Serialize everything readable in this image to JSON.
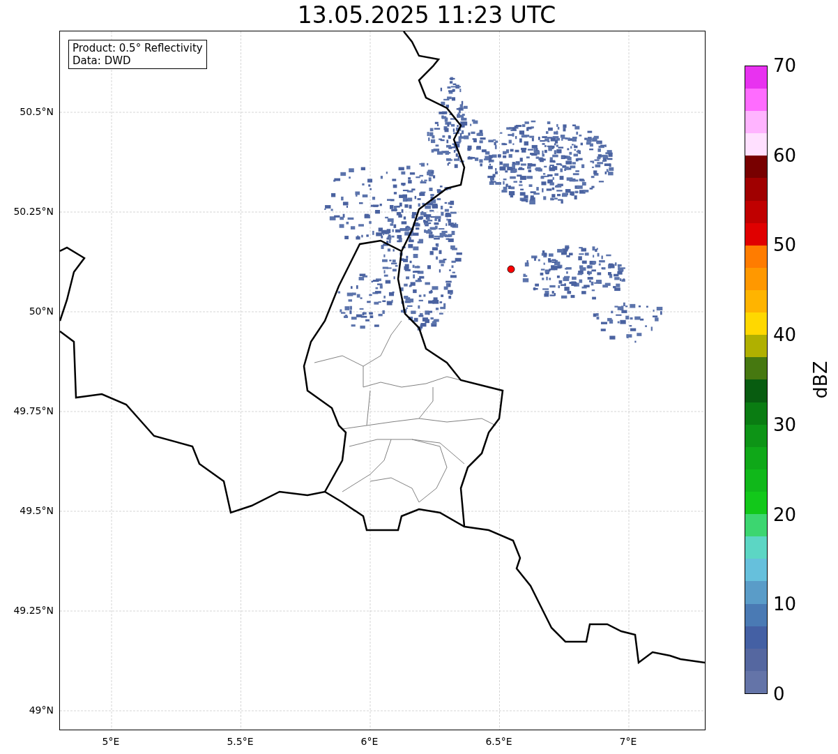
{
  "title": "13.05.2025 11:23 UTC",
  "info_box": {
    "lines": [
      "Product: 0.5° Reflectivity",
      "Data: DWD"
    ]
  },
  "map": {
    "xticks": [
      "5°E",
      "5.5°E",
      "6°E",
      "6.5°E",
      "7°E"
    ],
    "yticks": [
      "50.5°N",
      "50.25°N",
      "50°N",
      "49.75°N",
      "49.5°N",
      "49.25°N",
      "49°N"
    ],
    "radar_site": {
      "color": "#ff0000"
    }
  },
  "colorbar": {
    "label": "dBZ",
    "ticks": [
      "70",
      "60",
      "50",
      "40",
      "30",
      "20",
      "10",
      "0"
    ],
    "segments": [
      {
        "color": "#6474a8"
      },
      {
        "color": "#5567a0"
      },
      {
        "color": "#4460a4"
      },
      {
        "color": "#4a7ab4"
      },
      {
        "color": "#5a9cc8"
      },
      {
        "color": "#66c0dc"
      },
      {
        "color": "#5cd6c4"
      },
      {
        "color": "#3cd670"
      },
      {
        "color": "#12c81a"
      },
      {
        "color": "#10b81a"
      },
      {
        "color": "#0fa818"
      },
      {
        "color": "#0d9416"
      },
      {
        "color": "#0a7c12"
      },
      {
        "color": "#085c10"
      },
      {
        "color": "#467810"
      },
      {
        "color": "#b0b000"
      },
      {
        "color": "#ffd800"
      },
      {
        "color": "#ffb400"
      },
      {
        "color": "#ff9800"
      },
      {
        "color": "#ff7c00"
      },
      {
        "color": "#e00000"
      },
      {
        "color": "#c00000"
      },
      {
        "color": "#a00000"
      },
      {
        "color": "#780000"
      },
      {
        "color": "#ffe0ff"
      },
      {
        "color": "#ffb4ff"
      },
      {
        "color": "#ff6cff"
      },
      {
        "color": "#e832f0"
      }
    ]
  }
}
